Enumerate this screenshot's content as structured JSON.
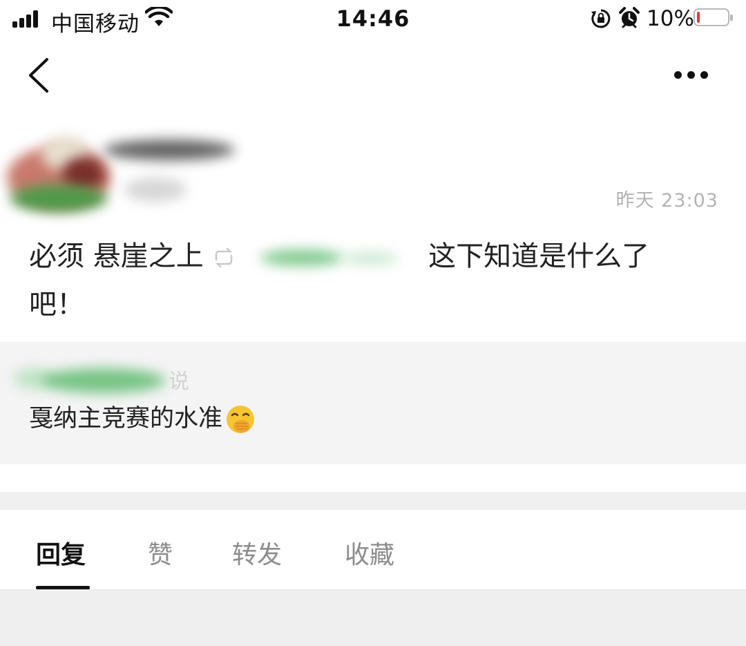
{
  "status_bar": {
    "carrier": "中国移动",
    "time": "14:46",
    "battery_percent": "10%",
    "battery_level": 0.1,
    "icons": [
      "signal-icon",
      "wifi-icon",
      "rotation-lock-icon",
      "alarm-icon",
      "battery-icon"
    ]
  },
  "nav": {
    "back_icon": "chevron-left-icon",
    "more_icon": "more-dots-icon"
  },
  "post": {
    "timestamp": "昨天 23:03",
    "text_before": "必须 悬崖之上",
    "text_after": "这下知道是什么了",
    "text_line2": "吧！"
  },
  "quote": {
    "author_tail": "说",
    "text": "戛纳主竞赛的水准",
    "emoji": "face-with-hand-over-mouth"
  },
  "tabs": [
    {
      "label": "回复",
      "active": true
    },
    {
      "label": "赞",
      "active": false
    },
    {
      "label": "转发",
      "active": false
    },
    {
      "label": "收藏",
      "active": false
    }
  ],
  "colors": {
    "accent": "#111111",
    "muted_text": "#8c8c8c",
    "quote_bg": "#f4f4f4",
    "battery_low": "#e53935",
    "redaction_green": "#58b86a"
  }
}
